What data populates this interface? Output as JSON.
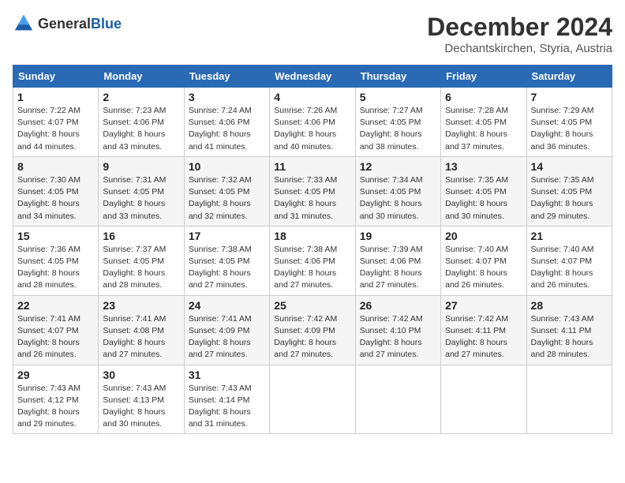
{
  "header": {
    "logo": {
      "general": "General",
      "blue": "Blue"
    },
    "month_year": "December 2024",
    "location": "Dechantskirchen, Styria, Austria"
  },
  "calendar": {
    "days_of_week": [
      "Sunday",
      "Monday",
      "Tuesday",
      "Wednesday",
      "Thursday",
      "Friday",
      "Saturday"
    ],
    "weeks": [
      [
        null,
        {
          "day": "2",
          "sunrise": "7:23 AM",
          "sunset": "4:06 PM",
          "daylight": "8 hours and 43 minutes."
        },
        {
          "day": "3",
          "sunrise": "7:24 AM",
          "sunset": "4:06 PM",
          "daylight": "8 hours and 41 minutes."
        },
        {
          "day": "4",
          "sunrise": "7:26 AM",
          "sunset": "4:06 PM",
          "daylight": "8 hours and 40 minutes."
        },
        {
          "day": "5",
          "sunrise": "7:27 AM",
          "sunset": "4:05 PM",
          "daylight": "8 hours and 38 minutes."
        },
        {
          "day": "6",
          "sunrise": "7:28 AM",
          "sunset": "4:05 PM",
          "daylight": "8 hours and 37 minutes."
        },
        {
          "day": "7",
          "sunrise": "7:29 AM",
          "sunset": "4:05 PM",
          "daylight": "8 hours and 36 minutes."
        }
      ],
      [
        {
          "day": "1",
          "sunrise": "7:22 AM",
          "sunset": "4:07 PM",
          "daylight": "8 hours and 44 minutes."
        },
        {
          "day": "9",
          "sunrise": "7:31 AM",
          "sunset": "4:05 PM",
          "daylight": "8 hours and 33 minutes."
        },
        {
          "day": "10",
          "sunrise": "7:32 AM",
          "sunset": "4:05 PM",
          "daylight": "8 hours and 32 minutes."
        },
        {
          "day": "11",
          "sunrise": "7:33 AM",
          "sunset": "4:05 PM",
          "daylight": "8 hours and 31 minutes."
        },
        {
          "day": "12",
          "sunrise": "7:34 AM",
          "sunset": "4:05 PM",
          "daylight": "8 hours and 30 minutes."
        },
        {
          "day": "13",
          "sunrise": "7:35 AM",
          "sunset": "4:05 PM",
          "daylight": "8 hours and 30 minutes."
        },
        {
          "day": "14",
          "sunrise": "7:35 AM",
          "sunset": "4:05 PM",
          "daylight": "8 hours and 29 minutes."
        }
      ],
      [
        {
          "day": "8",
          "sunrise": "7:30 AM",
          "sunset": "4:05 PM",
          "daylight": "8 hours and 34 minutes."
        },
        {
          "day": "16",
          "sunrise": "7:37 AM",
          "sunset": "4:05 PM",
          "daylight": "8 hours and 28 minutes."
        },
        {
          "day": "17",
          "sunrise": "7:38 AM",
          "sunset": "4:05 PM",
          "daylight": "8 hours and 27 minutes."
        },
        {
          "day": "18",
          "sunrise": "7:38 AM",
          "sunset": "4:06 PM",
          "daylight": "8 hours and 27 minutes."
        },
        {
          "day": "19",
          "sunrise": "7:39 AM",
          "sunset": "4:06 PM",
          "daylight": "8 hours and 27 minutes."
        },
        {
          "day": "20",
          "sunrise": "7:40 AM",
          "sunset": "4:07 PM",
          "daylight": "8 hours and 26 minutes."
        },
        {
          "day": "21",
          "sunrise": "7:40 AM",
          "sunset": "4:07 PM",
          "daylight": "8 hours and 26 minutes."
        }
      ],
      [
        {
          "day": "15",
          "sunrise": "7:36 AM",
          "sunset": "4:05 PM",
          "daylight": "8 hours and 28 minutes."
        },
        {
          "day": "23",
          "sunrise": "7:41 AM",
          "sunset": "4:08 PM",
          "daylight": "8 hours and 27 minutes."
        },
        {
          "day": "24",
          "sunrise": "7:41 AM",
          "sunset": "4:09 PM",
          "daylight": "8 hours and 27 minutes."
        },
        {
          "day": "25",
          "sunrise": "7:42 AM",
          "sunset": "4:09 PM",
          "daylight": "8 hours and 27 minutes."
        },
        {
          "day": "26",
          "sunrise": "7:42 AM",
          "sunset": "4:10 PM",
          "daylight": "8 hours and 27 minutes."
        },
        {
          "day": "27",
          "sunrise": "7:42 AM",
          "sunset": "4:11 PM",
          "daylight": "8 hours and 27 minutes."
        },
        {
          "day": "28",
          "sunrise": "7:43 AM",
          "sunset": "4:11 PM",
          "daylight": "8 hours and 28 minutes."
        }
      ],
      [
        {
          "day": "22",
          "sunrise": "7:41 AM",
          "sunset": "4:07 PM",
          "daylight": "8 hours and 26 minutes."
        },
        {
          "day": "30",
          "sunrise": "7:43 AM",
          "sunset": "4:13 PM",
          "daylight": "8 hours and 30 minutes."
        },
        {
          "day": "31",
          "sunrise": "7:43 AM",
          "sunset": "4:14 PM",
          "daylight": "8 hours and 31 minutes."
        },
        null,
        null,
        null,
        null
      ],
      [
        {
          "day": "29",
          "sunrise": "7:43 AM",
          "sunset": "4:12 PM",
          "daylight": "8 hours and 29 minutes."
        },
        null,
        null,
        null,
        null,
        null,
        null
      ]
    ]
  }
}
